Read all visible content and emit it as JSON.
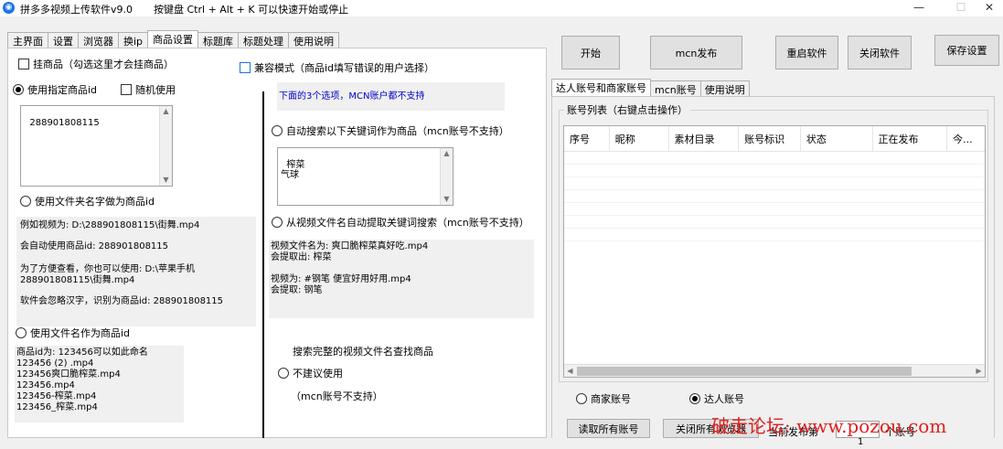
{
  "window": {
    "title": "拼多多视频上传软件v9.0",
    "hint": "按键盘 Ctrl + Alt + K  可以快速开始或停止",
    "minimize_glyph": "—",
    "maximize_glyph": "☐",
    "close_glyph": "✕"
  },
  "tabs": [
    "主界面",
    "设置",
    "浏览器",
    "换ip",
    "商品设置",
    "标题库",
    "标题处理",
    "使用说明"
  ],
  "product": {
    "mount_label": "挂商品（勾选这里才会挂商品）",
    "compat_label": "兼容模式（商品id填写错误的用户选择）",
    "use_specified_label": "使用指定商品id",
    "random_label": "随机使用",
    "specified_id_value": "288901808115",
    "use_folder_name_label": "使用文件夹名字做为商品id",
    "folder_note_1": "例如视频为: D:\\288901808115\\街舞.mp4",
    "folder_note_2": "会自动使用商品id: 288901808115",
    "folder_note_3": "为了方便查看，你也可以使用: D:\\苹果手机\n288901808115\\街舞.mp4",
    "folder_note_4": "软件会忽略汉字，识别为商品id: 288901808115",
    "use_file_name_label": "使用文件名作为商品id",
    "file_name_note": "商品id为: 123456可以如此命名\n123456 (2) .mp4\n123456爽口脆榨菜.mp4\n123456.mp4\n123456-榨菜.mp4\n123456_榨菜.mp4",
    "warning": "下面的3个选项，MCN账户都不支持",
    "auto_search_label": "自动搜索以下关键词作为商品（mcn账号不支持）",
    "keywords_value": "榨菜\n气球",
    "extract_label": "从视频文件名自动提取关键词搜索（mcn账号不支持）",
    "extract_note": "视频文件名为: 爽口脆榨菜真好吃.mp4\n会提取出: 榨菜\n\n视频为: #钢笔 便宜好用好用.mp4\n会提取: 钢笔",
    "full_search_title": "搜索完整的视频文件名查找商品",
    "not_recommended_label": "不建议使用",
    "mcn_not_supported": "（mcn账号不支持）"
  },
  "buttons": {
    "start": "开始",
    "mcn_publish": "mcn发布",
    "restart": "重启软件",
    "close": "关闭软件",
    "save": "保存设置"
  },
  "right_tabs": [
    "达人账号和商家账号",
    "mcn账号",
    "使用说明"
  ],
  "accounts": {
    "group_label": "账号列表（右键点击操作）",
    "columns": [
      "序号",
      "昵称",
      "素材目录",
      "账号标识",
      "状态",
      "正在发布",
      "今..."
    ],
    "merchant_label": "商家账号",
    "influencer_label": "达人账号",
    "read_all_button": "读取所有账号",
    "close_browsers_button": "关闭所有浏览器",
    "current_publish_label": "当前发布第",
    "current_publish_value": "1",
    "account_suffix": "个账号"
  },
  "watermark": "破走论坛:  www.pozou.com",
  "colors": {
    "accent": "#1a73e8",
    "watermark": "#e02020",
    "warning_text": "#0000cc"
  }
}
